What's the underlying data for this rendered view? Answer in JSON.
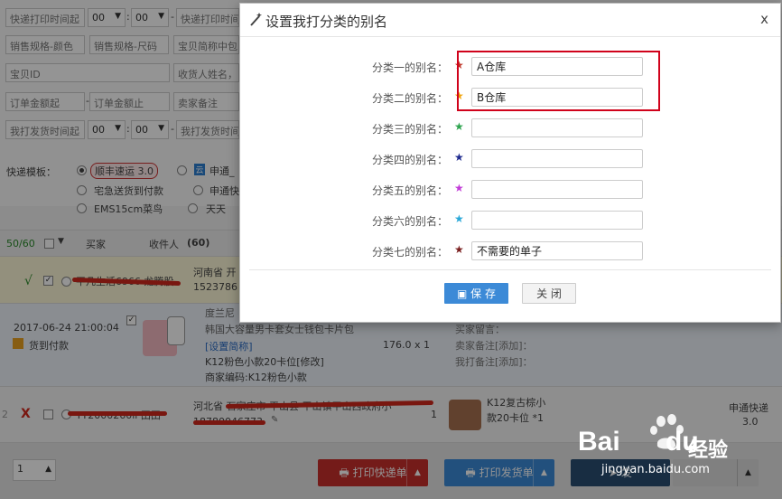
{
  "filters": {
    "row1": [
      "快递打印时间起",
      "00",
      "00",
      "快递打印时间止"
    ],
    "row2": [
      "销售规格-颜色",
      "销售规格-尺码",
      "宝贝简称中包"
    ],
    "row3": [
      "宝贝ID",
      "收货人姓名，"
    ],
    "row4": [
      "订单金额起",
      "订单金额止",
      "卖家备注"
    ],
    "row5": [
      "我打发货时间起",
      "00",
      "00",
      "我打发货时间止"
    ],
    "dash": "-"
  },
  "express": {
    "label": "快递模板：",
    "options": [
      "顺丰速运 3.0",
      "申通_",
      "宅急送货到付款",
      "申通快",
      "EMS15cm菜鸟",
      "天天"
    ]
  },
  "table": {
    "count": "50/60",
    "col_buyer": "买家",
    "col_receiver": "收件人",
    "col_receiver_count": "(60)"
  },
  "order1": {
    "check": "√",
    "name": "平凡生活6966  龙腾股",
    "address": "河南省 开",
    "phone": "1523786"
  },
  "order1b": {
    "time": "2017-06-24 21:00:04",
    "payment": "货到付款",
    "shop": "度兰尼",
    "title": "韩国大容量男卡套女士钱包卡片包",
    "set_short": "[设置简称]",
    "spec": "K12粉色小款20卡位[修改]",
    "code": "商家编码:K12粉色小款",
    "price": "176.0 x 1",
    "buyer_msg": "买家留言：",
    "seller_note": "卖家备注[添加]：",
    "my_note": "我打备注[添加]："
  },
  "order2": {
    "index": "2",
    "mark": "X",
    "name": "TT2000260li  田田",
    "address": "河北省 石家庄市 平山县 平山镇平山西政府小",
    "phone": "18780046773",
    "qty": "1",
    "item": "K12复古棕小款20卡位 *1",
    "express": "申通快递",
    "express_ver": "3.0"
  },
  "footer": {
    "page": "1",
    "print_express": "打印快递单",
    "print_ship": "打印发货单",
    "ship": "发"
  },
  "dialog": {
    "title": "设置我打分类的别名",
    "close_x": "x",
    "fields": [
      {
        "label": "分类一的别名：",
        "value": "A仓库",
        "star_color": "#c0392b"
      },
      {
        "label": "分类二的别名：",
        "value": "B仓库",
        "star_color": "#f0a30a"
      },
      {
        "label": "分类三的别名：",
        "value": "",
        "star_color": "#2ea44f"
      },
      {
        "label": "分类四的别名：",
        "value": "",
        "star_color": "#1f2b8f"
      },
      {
        "label": "分类五的别名：",
        "value": "",
        "star_color": "#c23cd8"
      },
      {
        "label": "分类六的别名：",
        "value": "",
        "star_color": "#2aa8d8"
      },
      {
        "label": "分类七的别名：",
        "value": "不需要的单子",
        "star_color": "#7a1f1f"
      }
    ],
    "save_label": "保 存",
    "close_label": "关 闭"
  },
  "watermark": {
    "brand": "Bai",
    "brand2": "du",
    "cn": "经验",
    "url": "jingyan.baidu.com"
  },
  "colors": {
    "red_button": "#c9302c",
    "blue_button": "#3c8ad7",
    "highlight": "#d0021b"
  }
}
